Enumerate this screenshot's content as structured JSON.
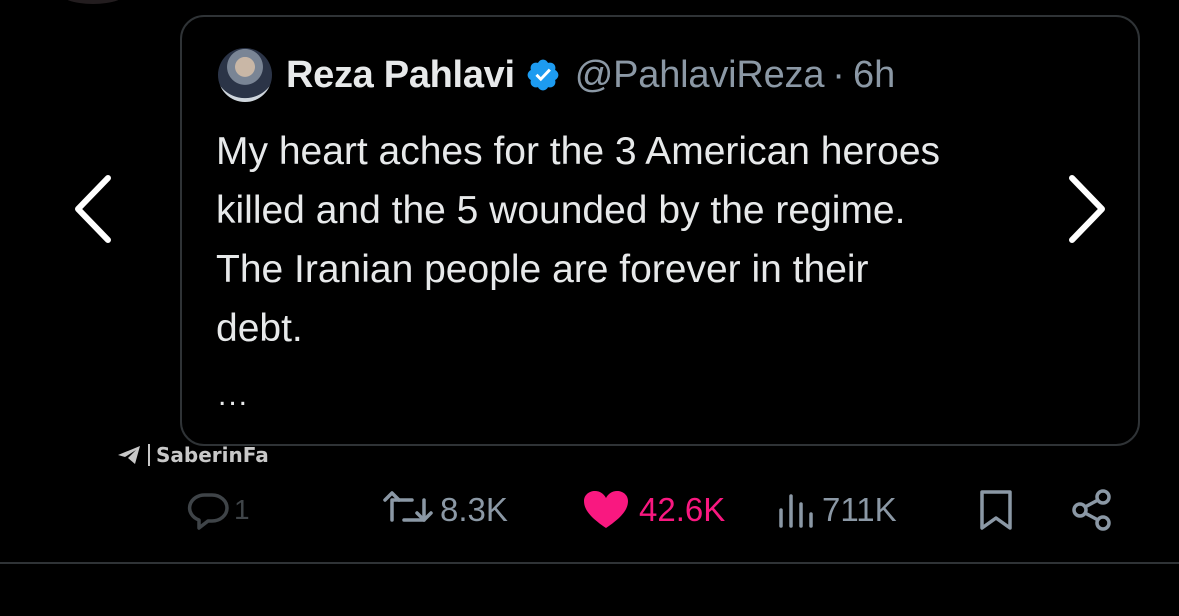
{
  "quoted_tweet": {
    "author_name": "Reza Pahlavi",
    "handle": "@PahlaviReza",
    "separator": "·",
    "time": "6h",
    "verified": true,
    "text_lines": [
      "My heart aches for the 3 American heroes",
      "killed and the 5 wounded by the regime.",
      "The Iranian people are forever in their",
      "debt."
    ],
    "more_indicator": "..."
  },
  "watermark": {
    "text": "SaberinFa"
  },
  "actions": {
    "reply_count": "1",
    "repost_count": "8.3K",
    "like_count": "42.6K",
    "views_count": "711K"
  },
  "colors": {
    "background": "#000000",
    "text_primary": "#e7e9ea",
    "text_secondary": "#8b98a5",
    "like_pink": "#f91880",
    "verified_blue": "#1d9bf0",
    "border": "#2f3336"
  },
  "icons": {
    "prev": "chevron-left-icon",
    "next": "chevron-right-icon",
    "reply": "reply-icon",
    "repost": "repost-icon",
    "like": "heart-icon",
    "views": "views-icon",
    "bookmark": "bookmark-icon",
    "share": "share-icon",
    "verified": "verified-badge-icon",
    "telegram": "telegram-icon"
  }
}
